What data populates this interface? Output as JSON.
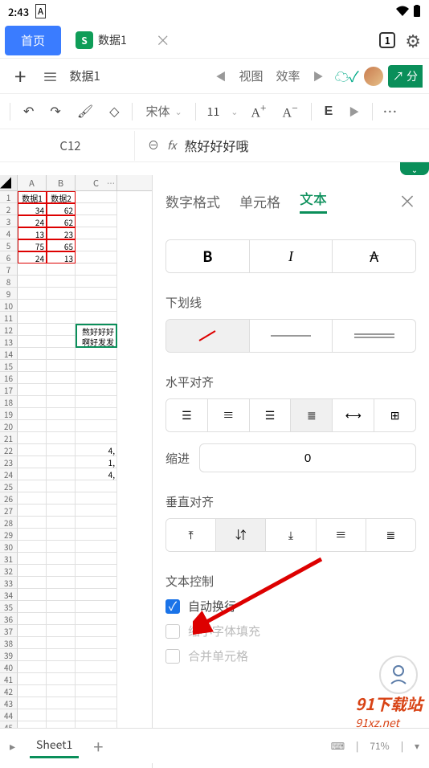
{
  "status": {
    "time": "2:43",
    "indicator": "A"
  },
  "topnav": {
    "home": "首页",
    "doc_name": "数据1",
    "tab_count": "1"
  },
  "doctoolbar": {
    "title": "数据1",
    "view": "视图",
    "efficiency": "效率"
  },
  "editbar": {
    "font": "宋体",
    "size": "11"
  },
  "cell": {
    "ref": "C12",
    "value": "熬好好好哦"
  },
  "grid": {
    "cols": [
      "A",
      "B",
      "C"
    ],
    "headers": [
      "数据1",
      "数据2"
    ],
    "data": [
      [
        "34",
        "62"
      ],
      [
        "24",
        "62"
      ],
      [
        "13",
        "23"
      ],
      [
        "75",
        "65"
      ],
      [
        "24",
        "13"
      ]
    ],
    "sel_text1": "熬好好好",
    "sel_text2": "啊好发发",
    "stray": {
      "r22": "4,",
      "r23": "1,",
      "r24": "4,"
    }
  },
  "panel": {
    "tabs": {
      "num": "数字格式",
      "cell": "单元格",
      "text": "文本"
    },
    "style": {
      "b": "B",
      "i": "I",
      "s": "A"
    },
    "underline": "下划线",
    "halign": "水平对齐",
    "indent": "缩进",
    "indent_val": "0",
    "valign": "垂直对齐",
    "textctrl": "文本控制",
    "wrap": "自动换行",
    "shrink": "缩小字体填充",
    "merge": "合并单元格"
  },
  "bottom": {
    "sheet": "Sheet1",
    "zoom": "71%"
  },
  "watermark": "91下载站\n91xz.net"
}
